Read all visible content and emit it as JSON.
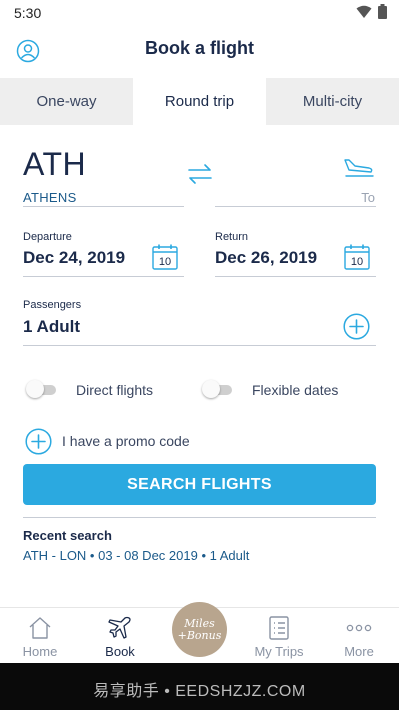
{
  "status_bar": {
    "time": "5:30"
  },
  "header": {
    "title": "Book a flight"
  },
  "tabs": [
    {
      "label": "One-way",
      "active": false
    },
    {
      "label": "Round trip",
      "active": true
    },
    {
      "label": "Multi-city",
      "active": false
    }
  ],
  "origin": {
    "code": "ATH",
    "city": "ATHENS"
  },
  "destination": {
    "placeholder": "To"
  },
  "departure": {
    "label": "Departure",
    "value": "Dec 24, 2019",
    "calendar_day": "10"
  },
  "return": {
    "label": "Return",
    "value": "Dec 26, 2019",
    "calendar_day": "10"
  },
  "passengers": {
    "label": "Passengers",
    "value": "1 Adult"
  },
  "options": {
    "direct_flights": {
      "label": "Direct flights",
      "on": false
    },
    "flexible_dates": {
      "label": "Flexible dates",
      "on": false
    }
  },
  "promo": {
    "label": "I have a promo code"
  },
  "search_button": {
    "label": "SEARCH FLIGHTS"
  },
  "recent": {
    "title": "Recent search",
    "items": [
      "ATH - LON • 03 - 08 Dec 2019 • 1 Adult"
    ]
  },
  "bottom_nav": {
    "items": [
      {
        "label": "Home",
        "icon": "home-icon",
        "active": false
      },
      {
        "label": "Book",
        "icon": "plane-icon",
        "active": true
      },
      {
        "label": "My Trips",
        "icon": "trips-icon",
        "active": false
      },
      {
        "label": "More",
        "icon": "more-icon",
        "active": false
      }
    ],
    "center": {
      "line1": "Miles",
      "line2": "+Bonus"
    }
  },
  "watermark": "易享助手 • EEDSHZJZ.COM",
  "colors": {
    "navy": "#1b2a4a",
    "accent": "#2ba9e0",
    "link_blue": "#1b5a8a",
    "miles_bonus": "#b8a58e",
    "tab_bg": "#eeeeee"
  }
}
